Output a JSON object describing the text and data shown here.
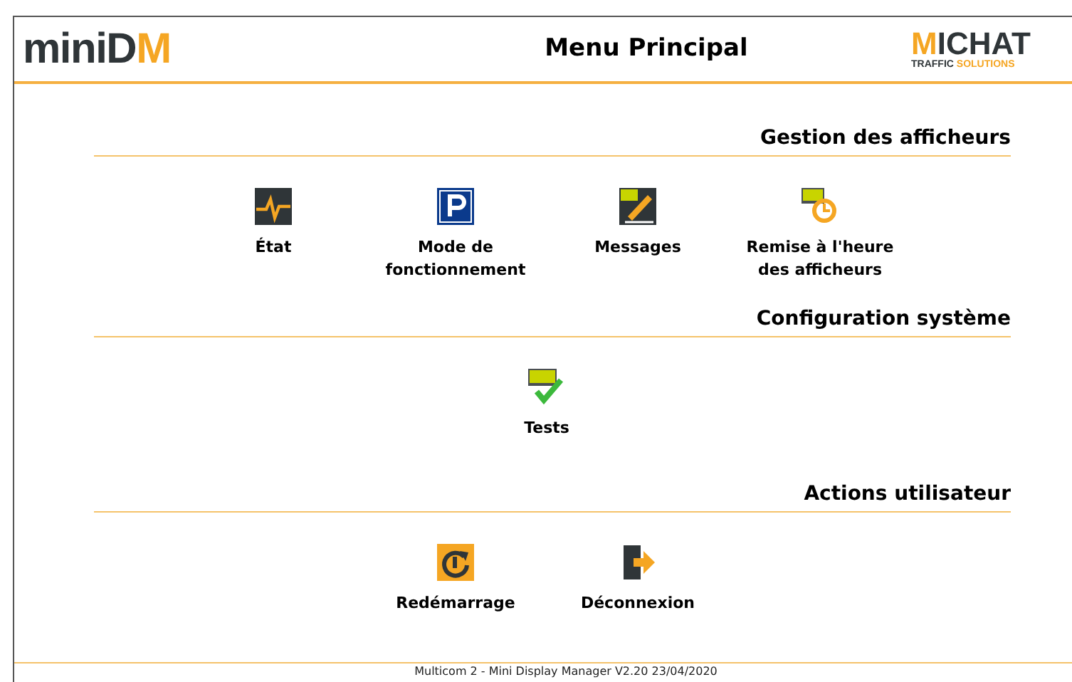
{
  "header": {
    "logo": {
      "main": "miniD",
      "accent": "M"
    },
    "title": "Menu Principal",
    "brand": {
      "name_accent": "M",
      "name": "ICHAT",
      "tagline_dark": "TRAFFIC",
      "tagline_accent": "SOLUTIONS"
    }
  },
  "sections": [
    {
      "title": "Gestion des afficheurs",
      "items": [
        {
          "kind": "pulse",
          "label": "État"
        },
        {
          "kind": "parking",
          "label": "Mode de fonctionnement"
        },
        {
          "kind": "edit",
          "label": "Messages"
        },
        {
          "kind": "clock",
          "label": "Remise à l'heure des afficheurs"
        }
      ]
    },
    {
      "title": "Configuration système",
      "items": [
        {
          "kind": "check",
          "label": "Tests"
        }
      ]
    },
    {
      "title": "Actions utilisateur",
      "items": [
        {
          "kind": "restart",
          "label": "Redémarrage"
        },
        {
          "kind": "logout",
          "label": "Déconnexion"
        }
      ]
    }
  ],
  "footer": "Multicom 2 - Mini Display Manager V2.20 23/04/2020"
}
